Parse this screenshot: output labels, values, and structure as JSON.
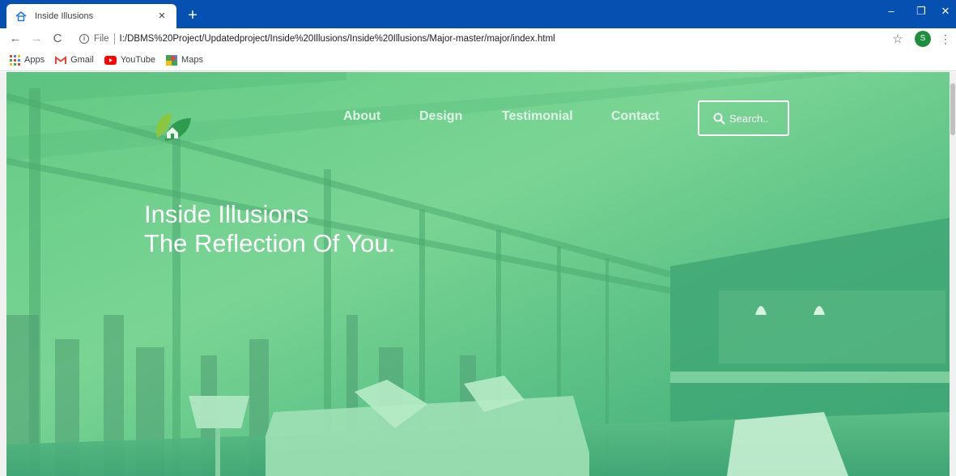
{
  "browser": {
    "tab_title": "Inside Illusions",
    "tab_close": "×",
    "new_tab": "+",
    "window_controls": {
      "minimize": "–",
      "restore": "❐",
      "close": "✕"
    },
    "nav": {
      "back": "←",
      "forward": "→",
      "reload": "C"
    },
    "file_label": "File",
    "url": "I:/DBMS%20Project/Updatedproject/Inside%20Illusions/Inside%20Illusions/Major-master/major/index.html",
    "profile_initial": "S",
    "menu": "⋮",
    "star": "☆"
  },
  "bookmarks": [
    {
      "label": "Apps",
      "icon": "apps-grid-icon"
    },
    {
      "label": "Gmail",
      "icon": "gmail-icon"
    },
    {
      "label": "YouTube",
      "icon": "youtube-icon"
    },
    {
      "label": "Maps",
      "icon": "maps-icon"
    }
  ],
  "site": {
    "nav": {
      "about": "About",
      "design": "Design",
      "testimonial": "Testimonial",
      "contact": "Contact"
    },
    "search_label": "Search..",
    "hero_line1": "Inside Illusions",
    "hero_line2": "The Reflection Of You."
  },
  "colors": {
    "chrome_blue": "#0550b0",
    "overlay_green": "#6fd08e",
    "overlay_green_dark": "#35a873"
  }
}
